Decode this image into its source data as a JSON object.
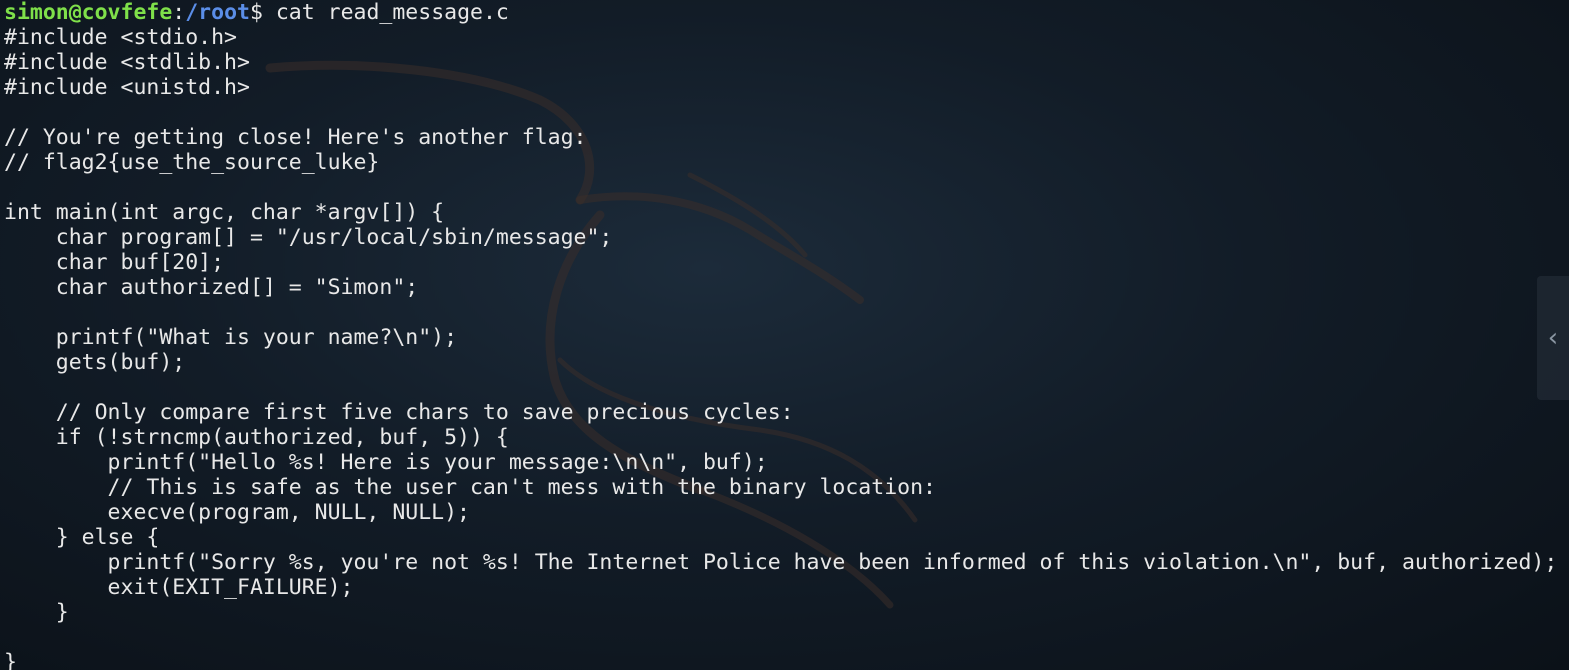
{
  "terminal": {
    "prompt": {
      "user_host": "simon@covfefe",
      "separator": ":",
      "path": "/root",
      "symbol": "$",
      "command": " cat read_message.c"
    },
    "lines": [
      "#include <stdio.h>",
      "#include <stdlib.h>",
      "#include <unistd.h>",
      "",
      "// You're getting close! Here's another flag:",
      "// flag2{use_the_source_luke}",
      "",
      "int main(int argc, char *argv[]) {",
      "    char program[] = \"/usr/local/sbin/message\";",
      "    char buf[20];",
      "    char authorized[] = \"Simon\";",
      "",
      "    printf(\"What is your name?\\n\");",
      "    gets(buf);",
      "",
      "    // Only compare first five chars to save precious cycles:",
      "    if (!strncmp(authorized, buf, 5)) {",
      "        printf(\"Hello %s! Here is your message:\\n\\n\", buf);",
      "        // This is safe as the user can't mess with the binary location:",
      "        execve(program, NULL, NULL);",
      "    } else {",
      "        printf(\"Sorry %s, you're not %s! The Internet Police have been informed of this violation.\\n\", buf, authorized);",
      "        exit(EXIT_FAILURE);",
      "    }",
      "",
      "}"
    ]
  },
  "side_handle": {
    "icon": "chevron-left-icon",
    "glyph": "‹"
  },
  "colors": {
    "prompt_user": "#7fe04a",
    "prompt_path": "#5b8ee8",
    "text": "#e8e8e8",
    "background": "#121c27"
  }
}
